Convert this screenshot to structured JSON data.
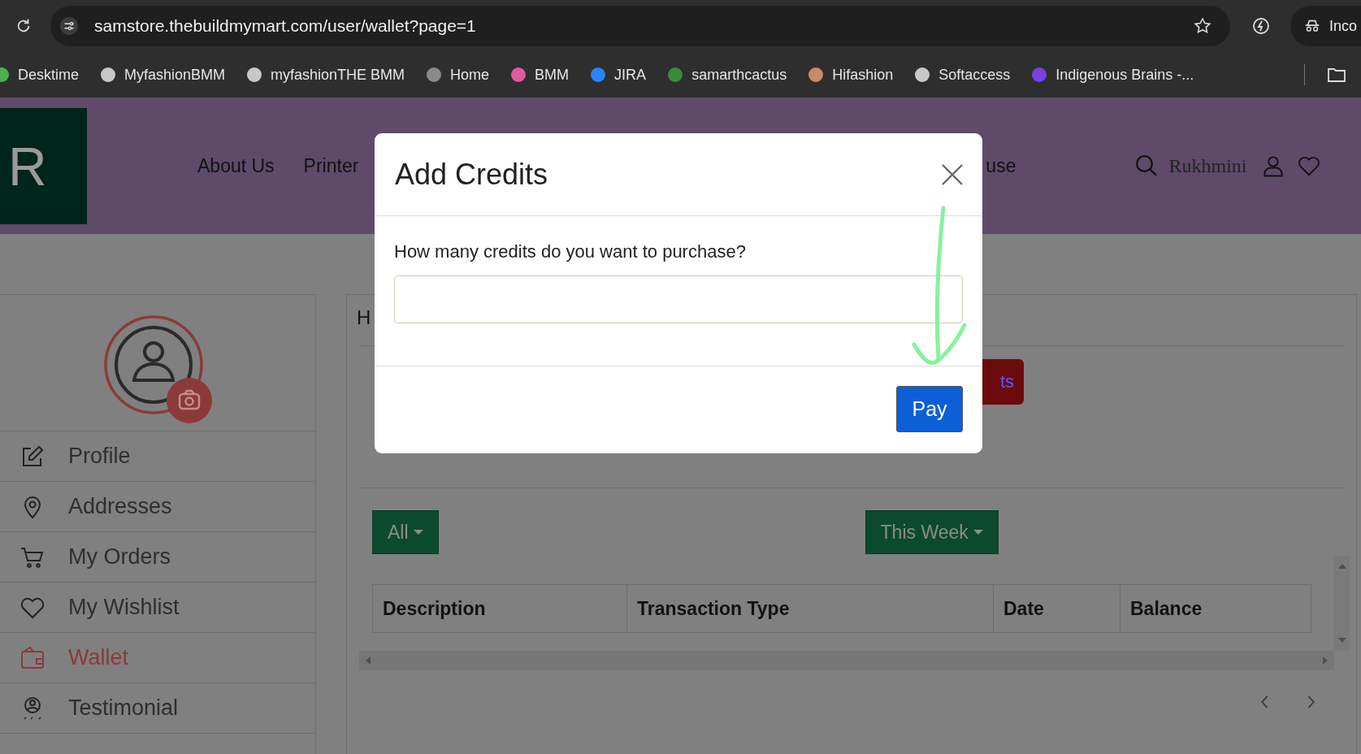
{
  "browser": {
    "url": "samstore.thebuildmymart.com/user/wallet?page=1",
    "profile_label": "Inco",
    "bookmarks": [
      {
        "label": "Desktime",
        "color": "#4caf50"
      },
      {
        "label": "MyfashionBMM",
        "color": "#c8c8c8"
      },
      {
        "label": "myfashionTHE BMM",
        "color": "#c8c8c8"
      },
      {
        "label": "Home",
        "color": "#8a8a8a"
      },
      {
        "label": "BMM",
        "color": "#e05aa0"
      },
      {
        "label": "JIRA",
        "color": "#2684ff"
      },
      {
        "label": "samarthcactus",
        "color": "#3c8a3c"
      },
      {
        "label": "Hifashion",
        "color": "#c98a6a"
      },
      {
        "label": "Softaccess",
        "color": "#c8c8c8"
      },
      {
        "label": "Indigenous Brains -...",
        "color": "#7b3fe4"
      }
    ]
  },
  "header": {
    "logo": "R",
    "nav": [
      "About Us",
      "Printer",
      "use"
    ],
    "user_name": "Rukhmini"
  },
  "sidebar": {
    "items": [
      {
        "label": "Profile",
        "selected": false
      },
      {
        "label": "Addresses",
        "selected": false
      },
      {
        "label": "My Orders",
        "selected": false
      },
      {
        "label": "My Wishlist",
        "selected": false
      },
      {
        "label": "Wallet",
        "selected": true
      },
      {
        "label": "Testimonial",
        "selected": false
      }
    ]
  },
  "main": {
    "breadcrumb": "H",
    "button_fragment": "ts",
    "filters": [
      "All",
      "This Week"
    ],
    "table": {
      "columns": [
        "Description",
        "Transaction Type",
        "Date",
        "Balance"
      ]
    }
  },
  "modal": {
    "title": "Add Credits",
    "question": "How many credits do you want to purchase?",
    "pay_button": "Pay"
  }
}
